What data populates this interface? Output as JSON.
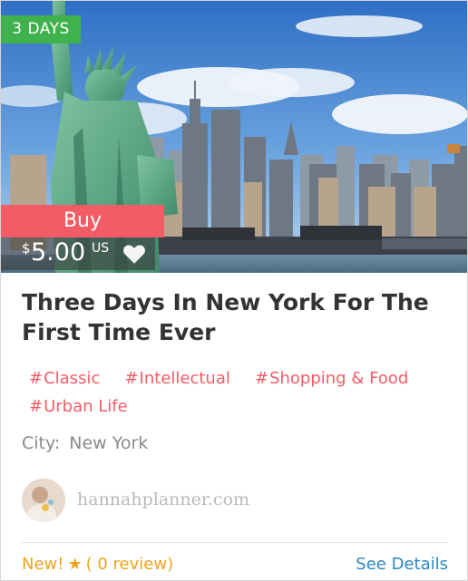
{
  "tour": {
    "duration_badge": "3 DAYS",
    "buy_label": "Buy",
    "price": {
      "currency_symbol": "$",
      "amount": "5.00",
      "currency_code": "US"
    },
    "title": "Three Days In New York For The First Time Ever",
    "tags": [
      {
        "hash": "#",
        "label": "Classic"
      },
      {
        "hash": "#",
        "label": "Intellectual"
      },
      {
        "hash": "#",
        "label": "Shopping & Food"
      },
      {
        "hash": "#",
        "label": "Urban Life"
      }
    ],
    "city": {
      "label": "City:",
      "value": "New York"
    },
    "author": "hannahplanner.com",
    "footer": {
      "new_label": "New!",
      "star": "★",
      "reviews": "( 0 review)",
      "details_label": "See Details"
    }
  },
  "colors": {
    "badge_green": "#3fb24d",
    "buy_red": "#f25c66",
    "tag_red": "#f25c66",
    "rating_orange": "#f0a31f",
    "link_blue": "#2b86c5"
  },
  "icons": [
    "heart-icon",
    "star-icon"
  ]
}
